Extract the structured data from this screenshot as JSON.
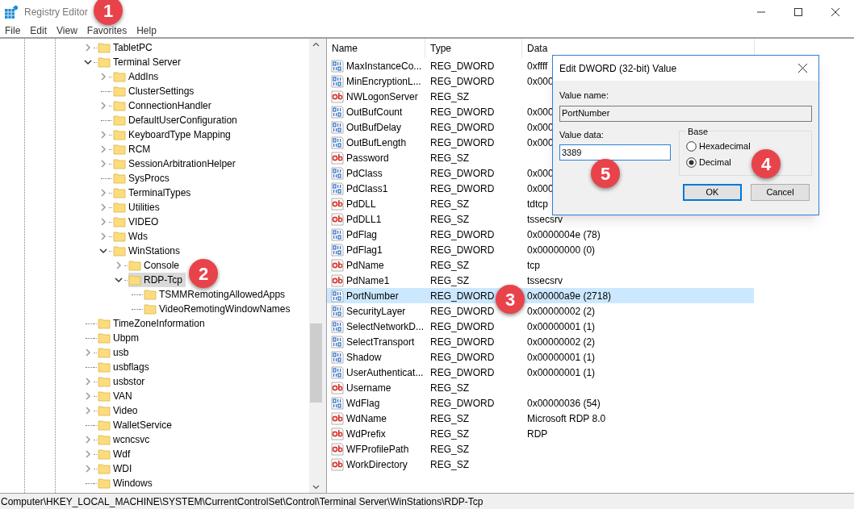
{
  "window": {
    "title": "Registry Editor"
  },
  "menu": [
    "File",
    "Edit",
    "View",
    "Favorites",
    "Help"
  ],
  "tree": [
    {
      "label": "TabletPC",
      "kind": "node",
      "expanded": false,
      "selected": false
    },
    {
      "label": "Terminal Server",
      "kind": "node",
      "expanded": true,
      "selected": false,
      "children": [
        {
          "label": "AddIns",
          "kind": "node",
          "expanded": false,
          "selected": false
        },
        {
          "label": "ClusterSettings",
          "kind": "leaf",
          "selected": false
        },
        {
          "label": "ConnectionHandler",
          "kind": "node",
          "expanded": false,
          "selected": false
        },
        {
          "label": "DefaultUserConfiguration",
          "kind": "leaf",
          "selected": false
        },
        {
          "label": "KeyboardType Mapping",
          "kind": "node",
          "expanded": false,
          "selected": false
        },
        {
          "label": "RCM",
          "kind": "node",
          "expanded": false,
          "selected": false
        },
        {
          "label": "SessionArbitrationHelper",
          "kind": "node",
          "expanded": false,
          "selected": false
        },
        {
          "label": "SysProcs",
          "kind": "leaf",
          "selected": false
        },
        {
          "label": "TerminalTypes",
          "kind": "node",
          "expanded": false,
          "selected": false
        },
        {
          "label": "Utilities",
          "kind": "node",
          "expanded": false,
          "selected": false
        },
        {
          "label": "VIDEO",
          "kind": "node",
          "expanded": false,
          "selected": false
        },
        {
          "label": "Wds",
          "kind": "node",
          "expanded": false,
          "selected": false
        },
        {
          "label": "WinStations",
          "kind": "node",
          "expanded": true,
          "selected": false,
          "children": [
            {
              "label": "Console",
              "kind": "node",
              "expanded": false,
              "selected": false
            },
            {
              "label": "RDP-Tcp",
              "kind": "node",
              "expanded": true,
              "selected": true,
              "children": [
                {
                  "label": "TSMMRemotingAllowedApps",
                  "kind": "leaf",
                  "selected": false
                },
                {
                  "label": "VideoRemotingWindowNames",
                  "kind": "leaf",
                  "selected": false
                }
              ]
            }
          ]
        }
      ]
    },
    {
      "label": "TimeZoneInformation",
      "kind": "leaf",
      "selected": false
    },
    {
      "label": "Ubpm",
      "kind": "leaf",
      "selected": false
    },
    {
      "label": "usb",
      "kind": "node",
      "expanded": false,
      "selected": false
    },
    {
      "label": "usbflags",
      "kind": "leaf",
      "selected": false
    },
    {
      "label": "usbstor",
      "kind": "node",
      "expanded": false,
      "selected": false
    },
    {
      "label": "VAN",
      "kind": "node",
      "expanded": false,
      "selected": false
    },
    {
      "label": "Video",
      "kind": "node",
      "expanded": false,
      "selected": false
    },
    {
      "label": "WalletService",
      "kind": "leaf",
      "selected": false
    },
    {
      "label": "wcncsvc",
      "kind": "node",
      "expanded": false,
      "selected": false
    },
    {
      "label": "Wdf",
      "kind": "node",
      "expanded": false,
      "selected": false
    },
    {
      "label": "WDI",
      "kind": "node",
      "expanded": false,
      "selected": false
    },
    {
      "label": "Windows",
      "kind": "leaf",
      "selected": false
    }
  ],
  "values": {
    "columns": [
      "Name",
      "Type",
      "Data"
    ],
    "rows": [
      {
        "name": "MaxInstanceCo...",
        "type": "REG_DWORD",
        "data": "0xffff",
        "kind": "dword",
        "selected": false
      },
      {
        "name": "MinEncryptionL...",
        "type": "REG_DWORD",
        "data": "0x000",
        "kind": "dword",
        "selected": false
      },
      {
        "name": "NWLogonServer",
        "type": "REG_SZ",
        "data": "",
        "kind": "sz",
        "selected": false
      },
      {
        "name": "OutBufCount",
        "type": "REG_DWORD",
        "data": "0x000",
        "kind": "dword",
        "selected": false
      },
      {
        "name": "OutBufDelay",
        "type": "REG_DWORD",
        "data": "0x000",
        "kind": "dword",
        "selected": false
      },
      {
        "name": "OutBufLength",
        "type": "REG_DWORD",
        "data": "0x000",
        "kind": "dword",
        "selected": false
      },
      {
        "name": "Password",
        "type": "REG_SZ",
        "data": "",
        "kind": "sz",
        "selected": false
      },
      {
        "name": "PdClass",
        "type": "REG_DWORD",
        "data": "0x000",
        "kind": "dword",
        "selected": false
      },
      {
        "name": "PdClass1",
        "type": "REG_DWORD",
        "data": "0x000",
        "kind": "dword",
        "selected": false
      },
      {
        "name": "PdDLL",
        "type": "REG_SZ",
        "data": "tdtcp",
        "kind": "sz",
        "selected": false
      },
      {
        "name": "PdDLL1",
        "type": "REG_SZ",
        "data": "tssecsrv",
        "kind": "sz",
        "selected": false
      },
      {
        "name": "PdFlag",
        "type": "REG_DWORD",
        "data": "0x0000004e (78)",
        "kind": "dword",
        "selected": false
      },
      {
        "name": "PdFlag1",
        "type": "REG_DWORD",
        "data": "0x00000000 (0)",
        "kind": "dword",
        "selected": false
      },
      {
        "name": "PdName",
        "type": "REG_SZ",
        "data": "tcp",
        "kind": "sz",
        "selected": false
      },
      {
        "name": "PdName1",
        "type": "REG_SZ",
        "data": "tssecsrv",
        "kind": "sz",
        "selected": false
      },
      {
        "name": "PortNumber",
        "type": "REG_DWORD",
        "data": "0x00000a9e (2718)",
        "kind": "dword",
        "selected": true
      },
      {
        "name": "SecurityLayer",
        "type": "REG_DWORD",
        "data": "0x00000002 (2)",
        "kind": "dword",
        "selected": false
      },
      {
        "name": "SelectNetworkD...",
        "type": "REG_DWORD",
        "data": "0x00000001 (1)",
        "kind": "dword",
        "selected": false
      },
      {
        "name": "SelectTransport",
        "type": "REG_DWORD",
        "data": "0x00000002 (2)",
        "kind": "dword",
        "selected": false
      },
      {
        "name": "Shadow",
        "type": "REG_DWORD",
        "data": "0x00000001 (1)",
        "kind": "dword",
        "selected": false
      },
      {
        "name": "UserAuthenticat...",
        "type": "REG_DWORD",
        "data": "0x00000001 (1)",
        "kind": "dword",
        "selected": false
      },
      {
        "name": "Username",
        "type": "REG_SZ",
        "data": "",
        "kind": "sz",
        "selected": false
      },
      {
        "name": "WdFlag",
        "type": "REG_DWORD",
        "data": "0x00000036 (54)",
        "kind": "dword",
        "selected": false
      },
      {
        "name": "WdName",
        "type": "REG_SZ",
        "data": "Microsoft RDP 8.0",
        "kind": "sz",
        "selected": false
      },
      {
        "name": "WdPrefix",
        "type": "REG_SZ",
        "data": "RDP",
        "kind": "sz",
        "selected": false
      },
      {
        "name": "WFProfilePath",
        "type": "REG_SZ",
        "data": "",
        "kind": "sz",
        "selected": false
      },
      {
        "name": "WorkDirectory",
        "type": "REG_SZ",
        "data": "",
        "kind": "sz",
        "selected": false
      }
    ]
  },
  "dialog": {
    "title": "Edit DWORD (32-bit) Value",
    "name_label": "Value name:",
    "name_value": "PortNumber",
    "data_label": "Value data:",
    "data_value": "3389",
    "base_label": "Base",
    "bases": [
      {
        "label": "Hexadecimal",
        "selected": false
      },
      {
        "label": "Decimal",
        "selected": true
      }
    ],
    "buttons": [
      "OK",
      "Cancel"
    ]
  },
  "markers": [
    "1",
    "2",
    "3",
    "4",
    "5"
  ],
  "status_bar": "Computer\\HKEY_LOCAL_MACHINE\\SYSTEM\\CurrentControlSet\\Control\\Terminal Server\\WinStations\\RDP-Tcp"
}
